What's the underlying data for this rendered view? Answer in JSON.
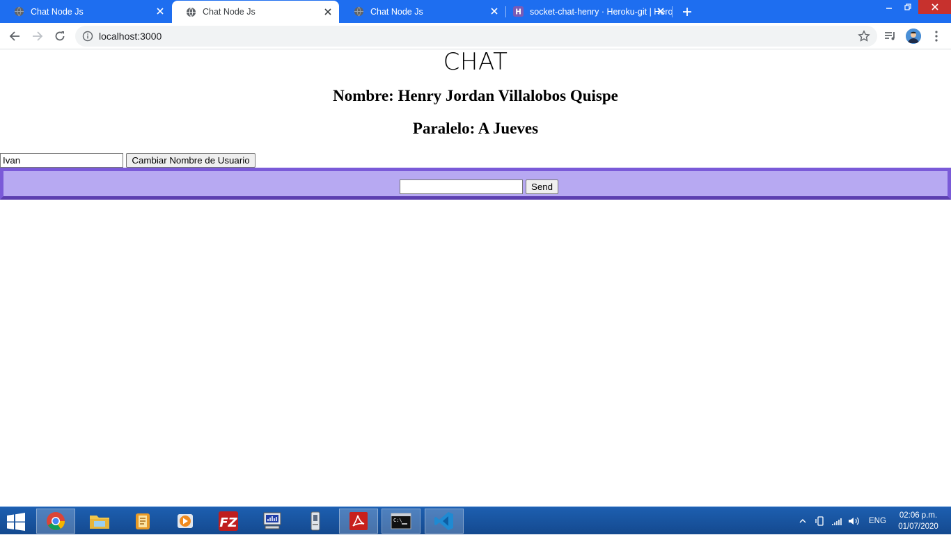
{
  "browser": {
    "tabs": [
      {
        "title": "Chat Node Js",
        "active": false
      },
      {
        "title": "Chat Node Js",
        "active": true
      },
      {
        "title": "Chat Node Js",
        "active": false
      },
      {
        "title": "socket-chat-henry · Heroku-git | Heroku",
        "active": false
      }
    ],
    "url": "localhost:3000"
  },
  "page": {
    "title": "CHAT",
    "nombre": "Nombre: Henry Jordan Villalobos Quispe",
    "paralelo": "Paralelo: A Jueves",
    "username_value": "Ivan",
    "change_button": "Cambiar Nombre de Usuario",
    "message_value": "",
    "send_button": "Send"
  },
  "taskbar": {
    "apps": [
      "chrome-icon",
      "file-explorer-icon",
      "notes-icon",
      "media-player-icon",
      "filezilla-icon",
      "network-monitor-icon",
      "usb-tool-icon",
      "acrobat-icon",
      "command-prompt-icon",
      "vscode-icon"
    ],
    "language": "ENG",
    "time": "02:06 p.m.",
    "date": "01/07/2020"
  },
  "colors": {
    "tabstrip": "#1e6ef0",
    "chat_bar": "#b7a9f2",
    "chat_bar_border": "#7a5ad8"
  }
}
